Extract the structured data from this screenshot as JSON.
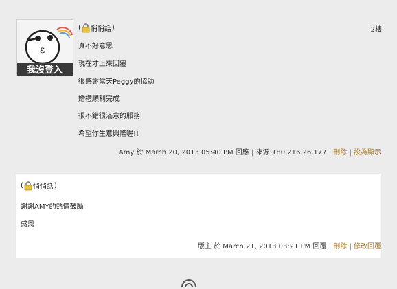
{
  "comment": {
    "private_label_open": "(",
    "private_label": "悄悄話",
    "private_label_close": ")",
    "floor": "2樓",
    "avatar_text": "我沒登入",
    "lines": [
      "真不好意思",
      "現在才上來回覆",
      "很感謝當天Peggy的協助",
      "婚禮順利完成",
      "很不錯很滿意的服務",
      "希望你生意興隆喔!!"
    ],
    "meta": {
      "author": "Amy",
      "date_prefix": "於",
      "date": "March 20, 2013 05:40 PM",
      "action": "回應",
      "source": "來源:180.216.26.177",
      "delete_label": "刪除",
      "set_visible_label": "設為顯示"
    }
  },
  "reply": {
    "private_label_open": "(",
    "private_label": "悄悄話",
    "private_label_close": ")",
    "lines": [
      "謝謝AMY的熱情鼓勵",
      "感恩"
    ],
    "meta": {
      "author": "版主",
      "date_prefix": "於",
      "date": "March 21, 2013 03:21 PM",
      "action": "回覆",
      "delete_label": "刪除",
      "edit_label": "修改回覆"
    }
  },
  "icons": {
    "avatar": "not-logged-in-avatar-icon",
    "lock": "lock-icon",
    "bottom": "footer-icon"
  }
}
